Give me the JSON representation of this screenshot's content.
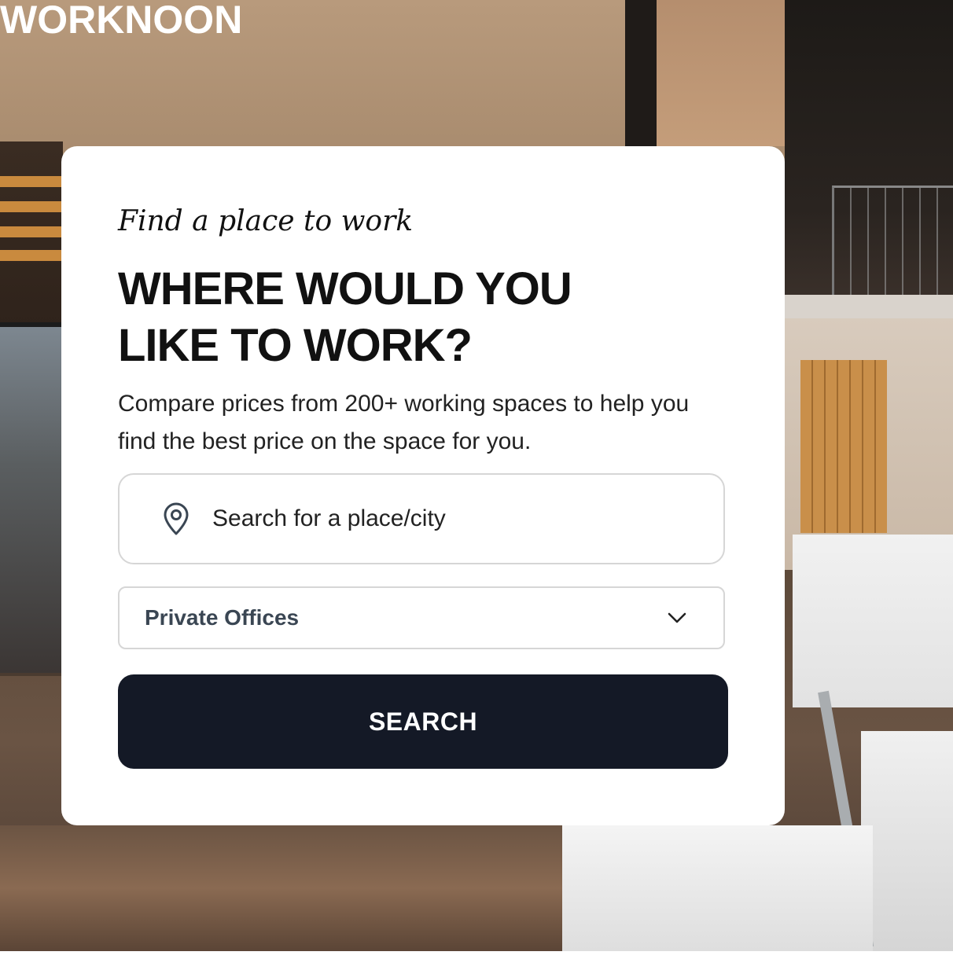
{
  "brand": {
    "logo_text": "WORKNOON"
  },
  "hero": {
    "tagline": "Find a place to work",
    "heading_line1": "WHERE WOULD YOU",
    "heading_line2": "LIKE TO WORK?",
    "description": "Compare prices from 200+ working spaces to help you find the best price on the space for you."
  },
  "search": {
    "placeholder": "Search for a place/city",
    "icon": "map-pin-icon"
  },
  "space_type": {
    "selected": "Private Offices",
    "icon": "chevron-down-icon"
  },
  "actions": {
    "search_label": "SEARCH"
  },
  "colors": {
    "button_bg": "#141926",
    "button_text": "#ffffff",
    "select_text": "#3a4653",
    "heading_text": "#111111"
  }
}
